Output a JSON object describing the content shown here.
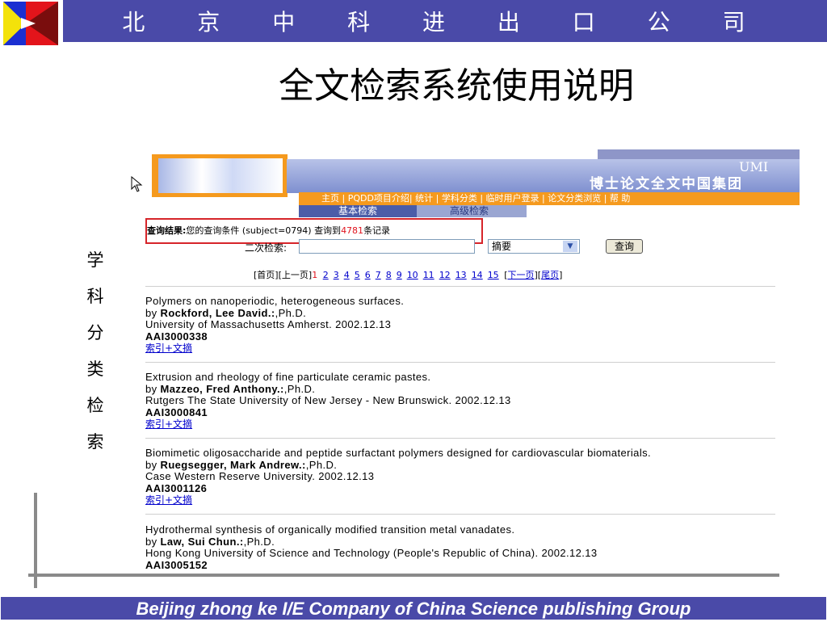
{
  "slide": {
    "company_title": "北 京 中 科 进 出 口 公 司",
    "title": "全文检索系统使用说明",
    "side_text": [
      "学",
      "科",
      "分",
      "类",
      "检",
      "索"
    ],
    "footer": "Beijing  zhong ke I/E Company of China Science publishing Group"
  },
  "colors": {
    "header_bg": "#4a4aa8",
    "banner_orange": "#f59a1e",
    "link": "#0000cc",
    "highlight_red": "#d6252a"
  },
  "site": {
    "brand": "UMI",
    "brand_title": "博士论文全文中国集团",
    "nav": [
      "主页",
      "PQDD项目介绍",
      "统计",
      "学科分类",
      "临时用户登录",
      "论文分类浏览",
      "帮 助"
    ],
    "nav_text": "主页 | PQDD项目介绍| 统计 | 学科分类 | 临时用户登录 | 论文分类浏览 | 帮 助",
    "tabs": {
      "basic": "基本检索",
      "advanced": "高级检索"
    }
  },
  "result": {
    "label": "查询结果:",
    "condition": "您的查询条件 (subject=0794) 查询到",
    "count": "4781",
    "suffix": "条记录"
  },
  "search": {
    "second_label": "二次检索:",
    "second_value": "",
    "field_value": "摘要",
    "button": "查询"
  },
  "pager": {
    "first": "[首页]",
    "prev": "[上一页]",
    "current": "1",
    "pages": [
      "2",
      "3",
      "4",
      "5",
      "6",
      "7",
      "8",
      "9",
      "10",
      "11",
      "12",
      "13",
      "14",
      "15"
    ],
    "next_open": "[",
    "next": "下一页",
    "next_close": "]",
    "last_open": "[",
    "last": "尾页",
    "last_close": "]"
  },
  "records": [
    {
      "title": "Polymers on nanoperiodic, heterogeneous surfaces.",
      "by": "by ",
      "author": "Rockford, Lee David.:",
      "degree": ",Ph.D.",
      "school": "University of Massachusetts Amherst. 2002.12.13",
      "id": "AAI3000338",
      "link": "索引+文摘"
    },
    {
      "title": "Extrusion and rheology of fine particulate ceramic pastes.",
      "by": "by ",
      "author": "Mazzeo, Fred Anthony.:",
      "degree": ",Ph.D.",
      "school": "Rutgers The State University of New Jersey - New Brunswick. 2002.12.13",
      "id": "AAI3000841",
      "link": "索引+文摘"
    },
    {
      "title": "Biomimetic oligosaccharide and peptide surfactant polymers designed for cardiovascular biomaterials.",
      "by": "by ",
      "author": "Ruegsegger, Mark Andrew.:",
      "degree": ",Ph.D.",
      "school": "Case Western Reserve University. 2002.12.13",
      "id": "AAI3001126",
      "link": "索引+文摘"
    },
    {
      "title": "Hydrothermal synthesis of organically modified transition metal vanadates.",
      "by": "by ",
      "author": "Law, Sui Chun.:",
      "degree": ",Ph.D.",
      "school": "Hong Kong University of Science and Technology (People's Republic of China). 2002.12.13",
      "id": "AAI3005152",
      "link": ""
    }
  ]
}
